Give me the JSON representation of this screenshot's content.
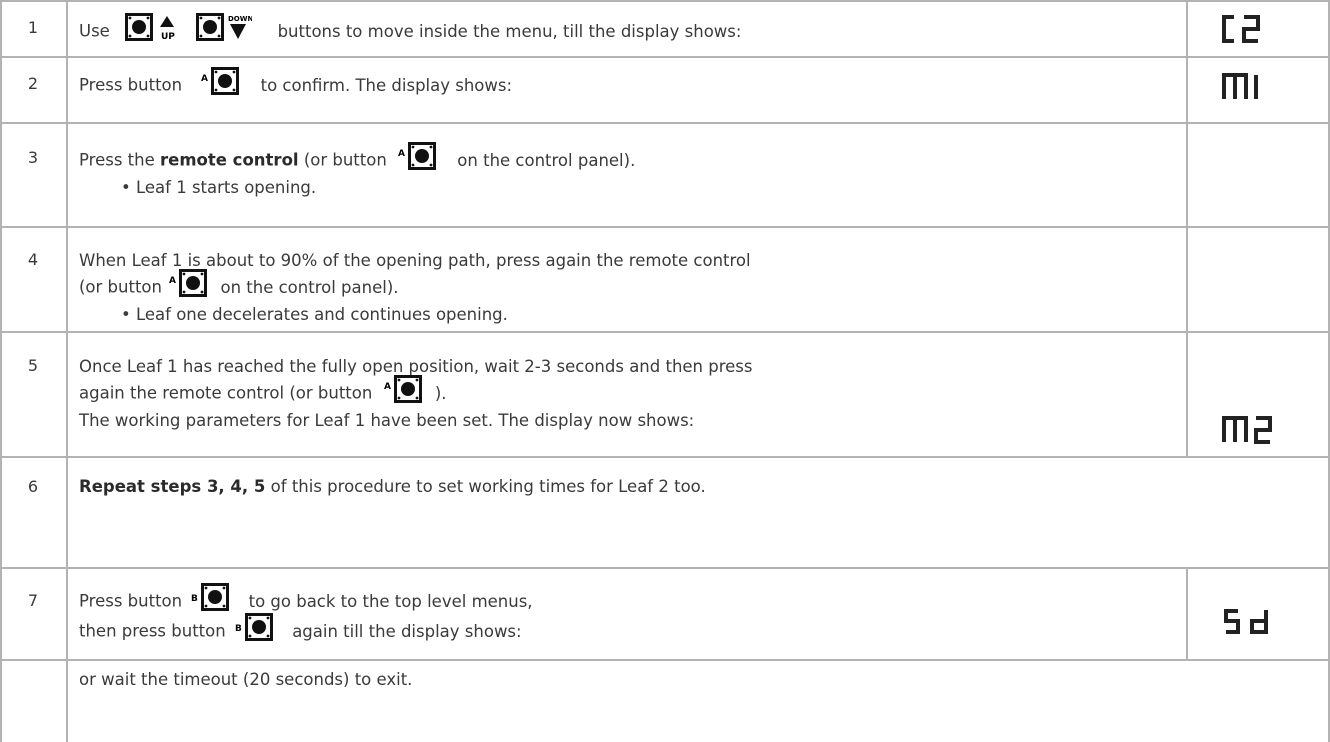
{
  "rows": [
    {
      "num": "1",
      "text_a": "Use",
      "text_b": "buttons to move inside the menu, till the display shows:",
      "display": "C2",
      "icons": [
        "up-button-icon",
        "down-button-icon"
      ],
      "icon_labels": [
        "UP",
        "DOWN"
      ]
    },
    {
      "num": "2",
      "text_a": "Press button",
      "text_b": "to confirm. The display shows:",
      "display": "M1",
      "icons": [
        "a-button-icon"
      ],
      "icon_labels": [
        "A"
      ]
    },
    {
      "num": "3",
      "text_a": "Press the",
      "bold": "remote control",
      "text_b": "(or button",
      "text_c": "on the control panel).",
      "bullet": "• Leaf 1 starts opening.",
      "icons": [
        "a-button-icon"
      ],
      "icon_labels": [
        "A"
      ]
    },
    {
      "num": "4",
      "line1": "When Leaf 1 is about to 90% of the opening path, press again the remote control",
      "text_a": "(or button",
      "text_b": "on the control panel).",
      "bullet": "• Leaf one decelerates and continues opening.",
      "icons": [
        "a-button-icon"
      ],
      "icon_labels": [
        "A"
      ]
    },
    {
      "num": "5",
      "line1": "Once Leaf 1 has reached the fully open position, wait 2-3 seconds and then press",
      "text_a": "again the remote control (or button",
      "text_b": ").",
      "line3": "The working parameters for Leaf 1 have been set. The display now shows:",
      "display": "M2",
      "icons": [
        "a-button-icon"
      ],
      "icon_labels": [
        "A"
      ]
    },
    {
      "num": "6",
      "bold": "Repeat steps 3, 4, 5",
      "text_a": "of this procedure to set working times for Leaf 2 too."
    },
    {
      "num": "7",
      "text_a": "Press button",
      "text_b": "to go back to the top level menus,",
      "text_c": "then press button",
      "text_d": "again till the display shows:",
      "display": "Sd",
      "footer": "or wait the timeout (20 seconds) to exit.",
      "icons": [
        "b-button-icon"
      ],
      "icon_labels": [
        "B"
      ]
    }
  ],
  "colors": {
    "border": "#b3b3b3",
    "text": "#3a3a3a",
    "display": "#222222"
  }
}
